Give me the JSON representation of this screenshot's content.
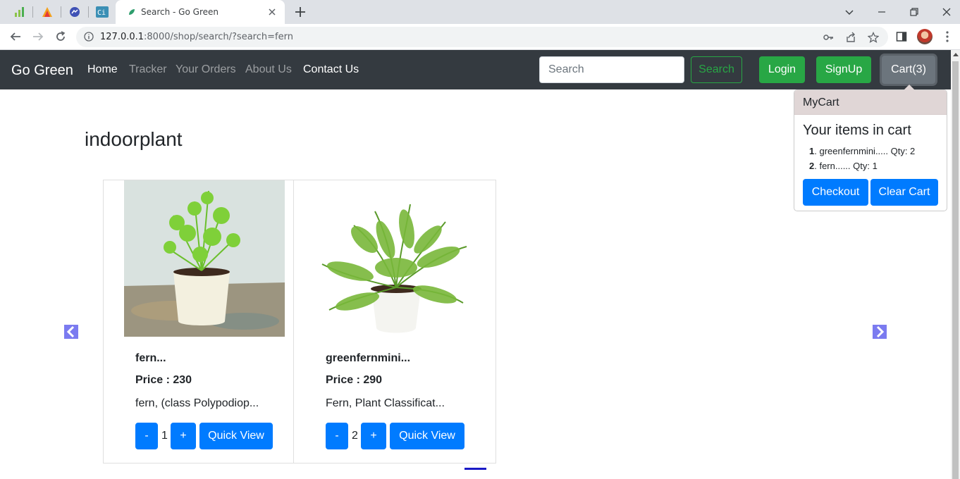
{
  "browser": {
    "tab_title": "Search - Go Green",
    "url_host": "127.0.0.1",
    "url_rest": ":8000/shop/search/?search=fern"
  },
  "navbar": {
    "brand": "Go Green",
    "links": [
      {
        "label": "Home",
        "active": true
      },
      {
        "label": "Tracker",
        "active": false
      },
      {
        "label": "Your Orders",
        "active": false
      },
      {
        "label": "About Us",
        "active": false
      },
      {
        "label": "Contact Us",
        "active": false
      }
    ],
    "search_placeholder": "Search",
    "search_button": "Search",
    "login_button": "Login",
    "signup_button": "SignUp",
    "cart_button": "Cart(3)"
  },
  "category": "indoorplant",
  "products": [
    {
      "name": "fern...",
      "price_label": "Price : 230",
      "description": "fern, (class Polypodiop...",
      "minus": "-",
      "qty": "1",
      "plus": "+",
      "quick_view": "Quick View"
    },
    {
      "name": "greenfernmini...",
      "price_label": "Price : 290",
      "description": "Fern, Plant Classificat...",
      "minus": "-",
      "qty": "2",
      "plus": "+",
      "quick_view": "Quick View"
    }
  ],
  "popover": {
    "header": "MyCart",
    "title": "Your items in cart",
    "items": [
      {
        "num": "1",
        "text": ". greenfernmini..... Qty: 2"
      },
      {
        "num": "2",
        "text": ". fern...... Qty: 1"
      }
    ],
    "checkout": "Checkout",
    "clear_cart": "Clear Cart"
  },
  "colors": {
    "navbar_bg": "#343a40",
    "success": "#28a745",
    "primary": "#007bff",
    "popover_header_bg": "#e0d6d6"
  }
}
